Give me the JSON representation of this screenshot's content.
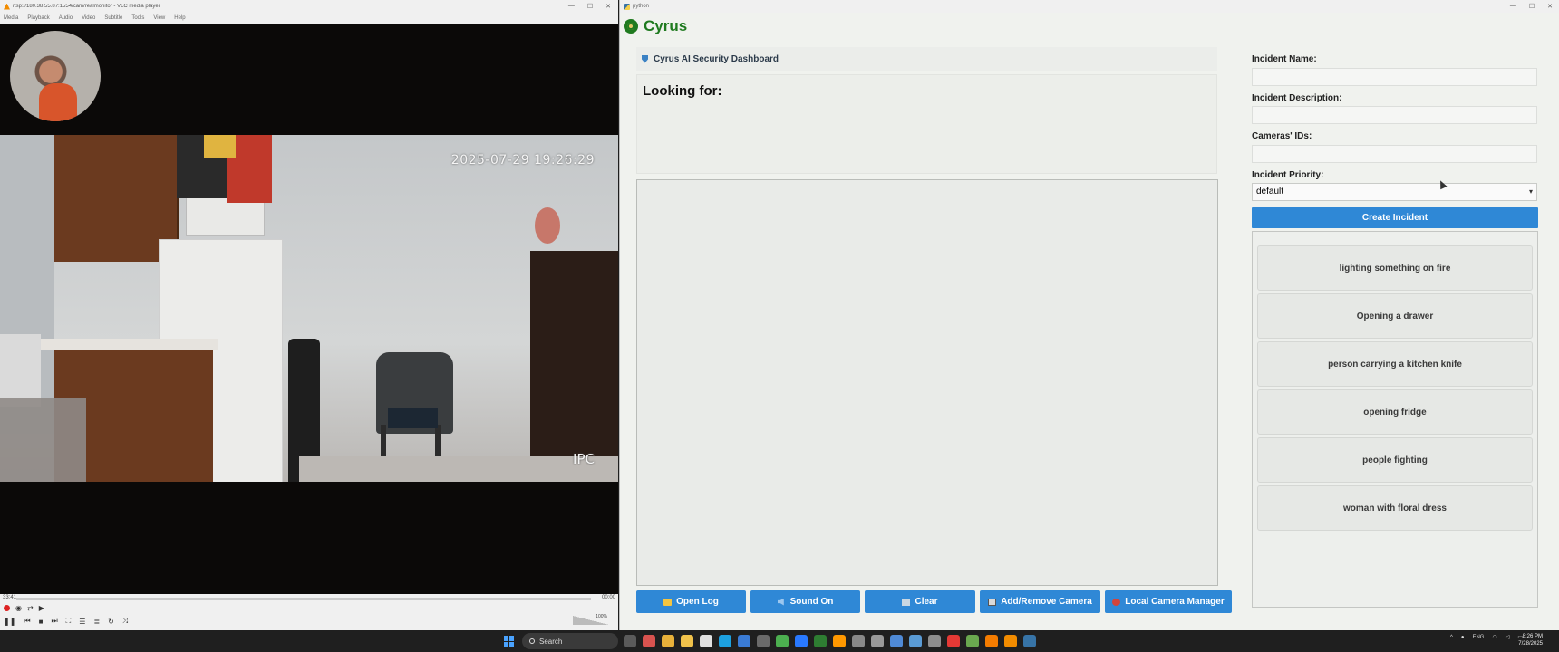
{
  "vlc": {
    "title": "rtsp://180.38.55.87:1554/cam/realmonitor - VLC media player",
    "menu": [
      "Media",
      "Playback",
      "Audio",
      "Video",
      "Subtitle",
      "Tools",
      "View",
      "Help"
    ],
    "timestamp": "2025-07-29 19:26:29",
    "camera_brand": "IPC",
    "time_elapsed": "33:41",
    "time_total": "00:00",
    "volume": "100%"
  },
  "app": {
    "window_title": "python",
    "brand": "Cyrus",
    "brand_color": "#1f7a1f",
    "dashboard_title": "Cyrus AI Security Dashboard",
    "looking_for_label": "Looking for:",
    "buttons": {
      "open_log": "Open Log",
      "sound_on": "Sound On",
      "clear": "Clear",
      "add_remove_camera": "Add/Remove Camera",
      "local_camera_manager": "Local Camera Manager"
    },
    "form": {
      "incident_name_label": "Incident Name:",
      "incident_name_value": "",
      "incident_description_label": "Incident Description:",
      "incident_description_value": "",
      "camera_ids_label": "Cameras' IDs:",
      "camera_ids_value": "",
      "priority_label": "Incident Priority:",
      "priority_value": "default"
    },
    "create_incident_label": "Create Incident",
    "incidents": [
      "lighting something on fire",
      "Opening a drawer",
      "person carrying a kitchen knife",
      "opening fridge",
      "people fighting",
      "woman with floral dress"
    ],
    "accent_color": "#2f88d6"
  },
  "taskbar": {
    "search_placeholder": "Search",
    "language": "ENG",
    "time": "8:26 PM",
    "date": "7/28/2025"
  }
}
